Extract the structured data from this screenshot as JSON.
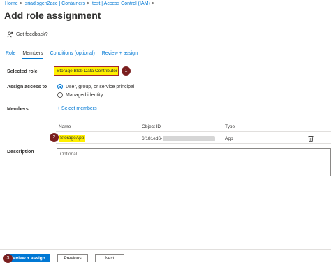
{
  "breadcrumb": {
    "home": "Home",
    "container_list": "sriadlsgen2acc | Containers",
    "current": "test | Access Control (IAM)"
  },
  "header": {
    "title": "Add role assignment",
    "more_label": "···"
  },
  "feedback": {
    "label": "Got feedback?"
  },
  "tabs": [
    {
      "label": "Role"
    },
    {
      "label": "Members"
    },
    {
      "label": "Conditions (optional)"
    },
    {
      "label": "Review + assign"
    }
  ],
  "form": {
    "selected_role_label": "Selected role",
    "selected_role_value": "Storage Blob Data Contributor",
    "assign_access_label": "Assign access to",
    "assign_options": [
      "User, group, or service principal",
      "Managed identity"
    ],
    "members_label": "Members",
    "select_members_link": "+ Select members",
    "description_label": "Description",
    "description_placeholder": "Optional"
  },
  "members_table": {
    "columns": [
      "Name",
      "Object ID",
      "Type"
    ],
    "rows": [
      {
        "name": "StorageApp",
        "object_id": "6f181ed6-",
        "type": "App"
      }
    ]
  },
  "steps": [
    "1",
    "2",
    "3"
  ],
  "footer": {
    "review_button": "Review + assign",
    "previous_button": "Previous",
    "next_button": "Next"
  },
  "colors": {
    "accent": "#0078d4",
    "highlight": "#fff000",
    "step_badge": "#7a1f1f"
  }
}
